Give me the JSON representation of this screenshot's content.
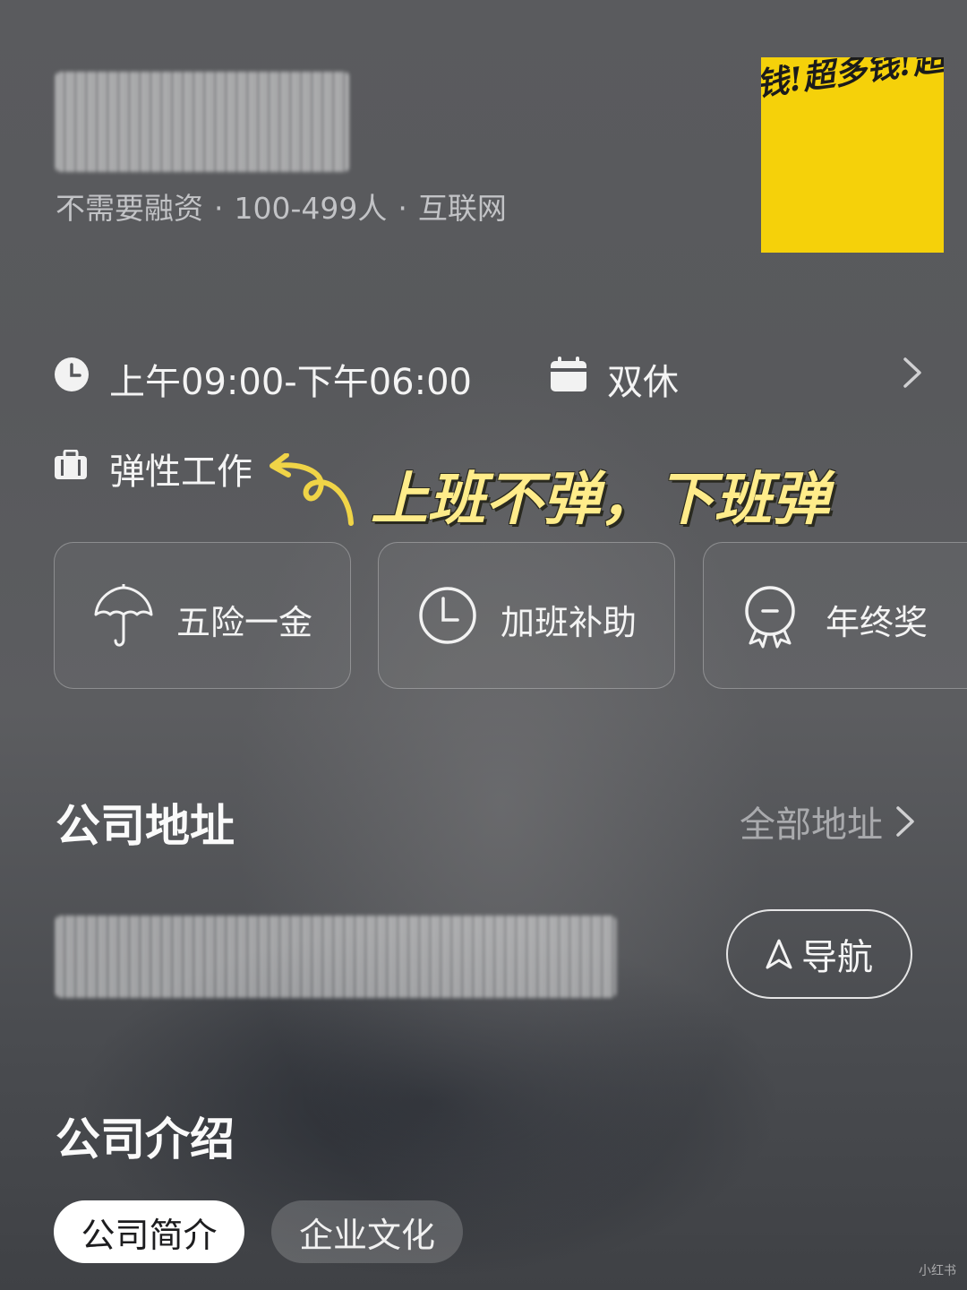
{
  "company": {
    "meta_funding": "不需要融资",
    "meta_size": "100-499人",
    "meta_industry": "互联网",
    "separator": "·",
    "logo_text": "钱!超多钱!超 多钱!超多钱! !超多钱!超多 多钱!超多钱!超 超多钱"
  },
  "schedule": {
    "hours": "上午09:00-下午06:00",
    "rest": "双休",
    "work_type": "弹性工作"
  },
  "annotation": "上班不弹，下班弹",
  "benefits": [
    {
      "label": "五险一金",
      "icon": "umbrella-icon"
    },
    {
      "label": "加班补助",
      "icon": "clock-icon"
    },
    {
      "label": "年终奖",
      "icon": "medal-icon"
    }
  ],
  "address": {
    "title": "公司地址",
    "all_link": "全部地址",
    "nav_button": "导航"
  },
  "intro": {
    "title": "公司介绍",
    "tabs": [
      {
        "label": "公司简介",
        "active": true
      },
      {
        "label": "企业文化",
        "active": false
      }
    ]
  },
  "watermark": "小红书",
  "colors": {
    "background": "#56575b",
    "annotation": "#ffec8a",
    "logo_bg": "#f5d10a"
  }
}
